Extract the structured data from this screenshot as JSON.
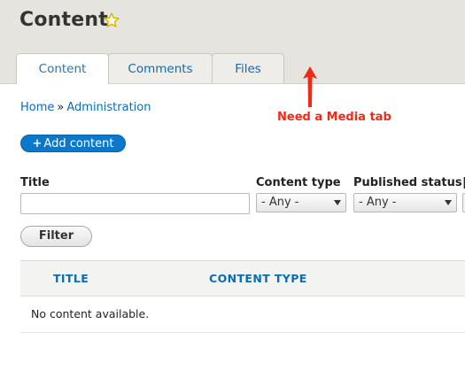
{
  "page": {
    "title": "Content"
  },
  "tabs": [
    {
      "label": "Content",
      "active": true
    },
    {
      "label": "Comments",
      "active": false
    },
    {
      "label": "Files",
      "active": false
    }
  ],
  "annotation": {
    "text": "Need a Media tab",
    "color": "#ee2b16"
  },
  "breadcrumb": {
    "items": [
      "Home",
      "Administration"
    ],
    "separator": "»"
  },
  "actions": {
    "add_content_plus": "+",
    "add_content_label": "Add content"
  },
  "filters": {
    "title_label": "Title",
    "title_value": "",
    "content_type_label": "Content type",
    "content_type_selected": "- Any -",
    "published_status_label": "Published status",
    "published_status_selected": "- Any -",
    "filter_button": "Filter"
  },
  "table": {
    "columns": [
      "TITLE",
      "CONTENT TYPE"
    ],
    "empty_message": "No content available."
  },
  "colors": {
    "link": "#0a6cb5",
    "primary_button": "#0d77c9",
    "header_bg": "#e6e4df"
  },
  "icons": {
    "favorite": "star-outline-icon",
    "annotation": "red-arrow-icon"
  }
}
